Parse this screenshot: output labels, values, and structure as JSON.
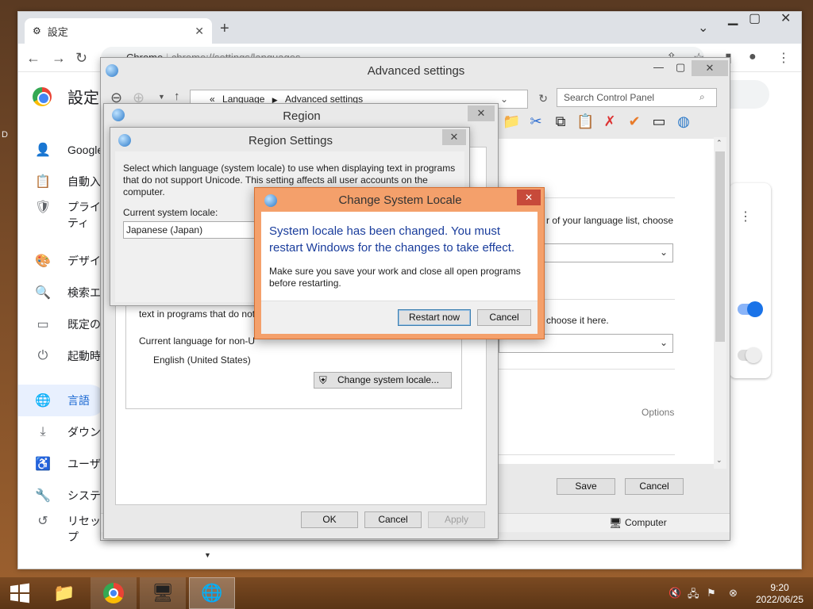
{
  "desktop": {
    "edge_glyph": "D"
  },
  "browser": {
    "tab_title": "設定",
    "url_scheme": "Chrome",
    "url": "chrome://settings/languages",
    "settings_title": "設定",
    "sidebar": [
      {
        "icon": "person-icon",
        "glyph": "👤",
        "label": "Google"
      },
      {
        "icon": "autofill-icon",
        "glyph": "📋",
        "label": "自動入"
      },
      {
        "icon": "shield-icon",
        "glyph": "🛡",
        "label": "プライ"
      },
      {
        "icon": "palette-icon",
        "glyph": "🎨",
        "label": "デザイ"
      },
      {
        "icon": "search-icon",
        "glyph": "🔍",
        "label": "検索エ"
      },
      {
        "icon": "browser-icon",
        "glyph": "▭",
        "label": "既定の"
      },
      {
        "icon": "power-icon",
        "glyph": "⏻",
        "label": "起動時"
      },
      {
        "icon": "globe-icon",
        "glyph": "🌐",
        "label": "言語"
      },
      {
        "icon": "download-icon",
        "glyph": "⤓",
        "label": "ダウン"
      },
      {
        "icon": "accessibility-icon",
        "glyph": "♿",
        "label": "ユーザ"
      },
      {
        "icon": "wrench-icon",
        "glyph": "🔧",
        "label": "システ"
      },
      {
        "icon": "reset-icon",
        "glyph": "↺",
        "label": "リセッ"
      }
    ],
    "sidebar_extra": {
      "privacy_line2": "ティ",
      "reset_line2": "プ"
    }
  },
  "advanced_settings": {
    "title": "Advanced settings",
    "address_prefix": "«",
    "breadcrumb": [
      "Language",
      "Advanced settings"
    ],
    "search_placeholder": "Search Control Panel",
    "text_list_choose": "r of your language list, choose",
    "text_choose_here": "choose it here.",
    "options_link": "Options",
    "save": "Save",
    "cancel": "Cancel",
    "status_computer": "Computer"
  },
  "region": {
    "title": "Region",
    "text_partial": "text in programs that do not",
    "current_nonunicode_label": "Current language for non-U",
    "current_nonunicode_value": "English (United States)",
    "change_locale_button": "Change system locale...",
    "ok": "OK",
    "cancel": "Cancel",
    "apply": "Apply"
  },
  "region_settings": {
    "title": "Region Settings",
    "description": "Select which language (system locale) to use when displaying text in programs that do not support Unicode. This setting affects all user accounts on the computer.",
    "current_locale_label": "Current system locale:",
    "current_locale_value": "Japanese (Japan)"
  },
  "change_locale_dialog": {
    "title": "Change System Locale",
    "main_instruction": "System locale has been changed. You must restart Windows for the changes to take effect.",
    "detail": "Make sure you save your work and close all open programs before restarting.",
    "restart_now": "Restart now",
    "cancel": "Cancel"
  },
  "taskbar": {
    "time": "9:20",
    "date": "2022/06/25"
  }
}
